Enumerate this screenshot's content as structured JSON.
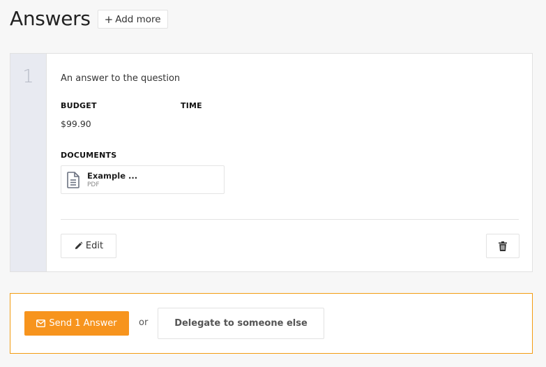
{
  "header": {
    "title": "Answers",
    "add_more_label": "Add more"
  },
  "answers": [
    {
      "number": "1",
      "text": "An answer to the question",
      "budget_label": "BUDGET",
      "budget_value": "$99.90",
      "time_label": "TIME",
      "time_value": "",
      "documents_label": "DOCUMENTS",
      "documents": [
        {
          "name": "Example ...",
          "type": "PDF",
          "icon": "file-text-icon"
        }
      ],
      "edit_label": "Edit",
      "delete_icon": "trash-icon"
    }
  ],
  "footer": {
    "send_label": "Send 1 Answer",
    "or_label": "or",
    "delegate_label": "Delegate to someone else"
  },
  "colors": {
    "accent": "#f7941d",
    "send_border": "#f39c12",
    "number_column": "#e8eaf1"
  }
}
